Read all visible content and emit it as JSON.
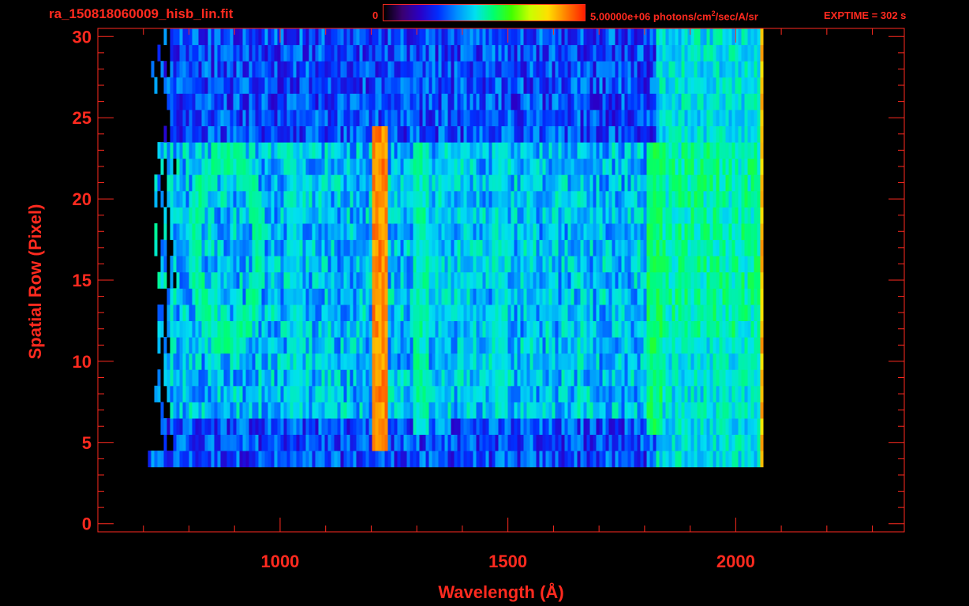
{
  "header": {
    "file_title": "ra_150818060009_hisb_lin.fit",
    "colorbar_min": "0",
    "colorbar_max_value": "5.00000e+06 photons/cm",
    "colorbar_max_exp": "2",
    "colorbar_max_units": "/sec/A/sr",
    "exptime": "EXPTIME = 302 s"
  },
  "colors": {
    "axis": "#ff2a1f",
    "background": "#000000",
    "colormap": [
      "#000000",
      "#3a0070",
      "#2a00c8",
      "#0030ff",
      "#0090ff",
      "#00e0f0",
      "#00ff70",
      "#40ff00",
      "#c8ff00",
      "#ffe000",
      "#ff8000",
      "#ff2000"
    ]
  },
  "chart_data": {
    "type": "heatmap",
    "title": "ra_150818060009_hisb_lin.fit",
    "xlabel": "Wavelength (Å)",
    "ylabel": "Spatial Row (Pixel)",
    "xlim": [
      600,
      2370
    ],
    "ylim": [
      -0.5,
      30.5
    ],
    "x_ticks": [
      1000,
      1500,
      2000
    ],
    "y_ticks": [
      0,
      5,
      10,
      15,
      20,
      25,
      30
    ],
    "color_range": [
      0,
      5000000
    ],
    "color_units": "photons/cm^2/sec/A/sr",
    "data_extent": {
      "x": [
        770,
        2060
      ],
      "y": [
        4,
        30
      ]
    },
    "features": [
      {
        "name": "ring",
        "center_x": 880,
        "center_y": 17,
        "radius_x": 70,
        "radius_y": 5.5,
        "level": 0.55
      },
      {
        "name": "band",
        "x": 1030,
        "rows": [
          7,
          23
        ],
        "level": 0.5
      },
      {
        "name": "band",
        "x": 1215,
        "rows": [
          5,
          24
        ],
        "level": 0.95
      },
      {
        "name": "band",
        "x": 1304,
        "rows": [
          6,
          23
        ],
        "level": 0.55
      },
      {
        "name": "band",
        "x": 1356,
        "rows": [
          6,
          23
        ],
        "level": 0.45
      },
      {
        "name": "band",
        "x": 1400,
        "rows": [
          7,
          22
        ],
        "level": 0.45
      },
      {
        "name": "band",
        "x": 1480,
        "rows": [
          7,
          23
        ],
        "level": 0.5
      },
      {
        "name": "band",
        "x": 1545,
        "rows": [
          7,
          23
        ],
        "level": 0.45
      },
      {
        "name": "band",
        "x": 1660,
        "rows": [
          7,
          23
        ],
        "level": 0.4
      },
      {
        "name": "band",
        "x": 1818,
        "rows": [
          6,
          23
        ],
        "level": 0.6
      },
      {
        "name": "continuum",
        "x_range": [
          1820,
          2050
        ],
        "rows": [
          12,
          23
        ],
        "level": 0.58
      },
      {
        "name": "edge",
        "x": 2055,
        "rows": [
          1,
          30
        ],
        "level": 0.9
      }
    ]
  }
}
